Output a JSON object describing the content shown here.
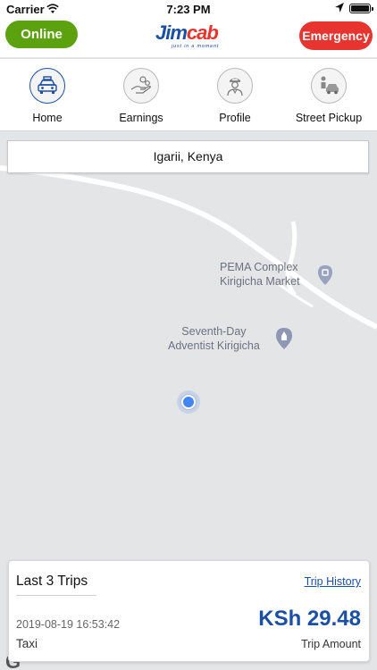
{
  "status_bar": {
    "carrier": "Carrier",
    "time": "7:23 PM"
  },
  "header": {
    "online_label": "Online",
    "emergency_label": "Emergency",
    "logo_primary": "Jim",
    "logo_secondary": "cab",
    "logo_tagline": "just in a moment"
  },
  "nav": {
    "items": [
      {
        "label": "Home",
        "icon": "taxi-icon",
        "active": true
      },
      {
        "label": "Earnings",
        "icon": "hand-coins-icon",
        "active": false
      },
      {
        "label": "Profile",
        "icon": "driver-icon",
        "active": false
      },
      {
        "label": "Street Pickup",
        "icon": "passenger-car-icon",
        "active": false
      }
    ]
  },
  "map": {
    "location": "Igarii, Kenya",
    "poi_1_line1": "PEMA Complex",
    "poi_1_line2": "Kirigicha Market",
    "poi_2_line1": "Seventh-Day",
    "poi_2_line2": "Adventist Kirigicha"
  },
  "trips": {
    "title": "Last 3 Trips",
    "history_link": "Trip History",
    "date": "2019-08-19 16:53:42",
    "type": "Taxi",
    "amount": "KSh 29.48",
    "amount_label": "Trip Amount"
  },
  "colors": {
    "online": "#5ba20e",
    "emergency": "#e8342e",
    "brand_blue": "#1b4fa3",
    "map_bg": "#e4e5e7",
    "user_dot": "#4285f4"
  }
}
